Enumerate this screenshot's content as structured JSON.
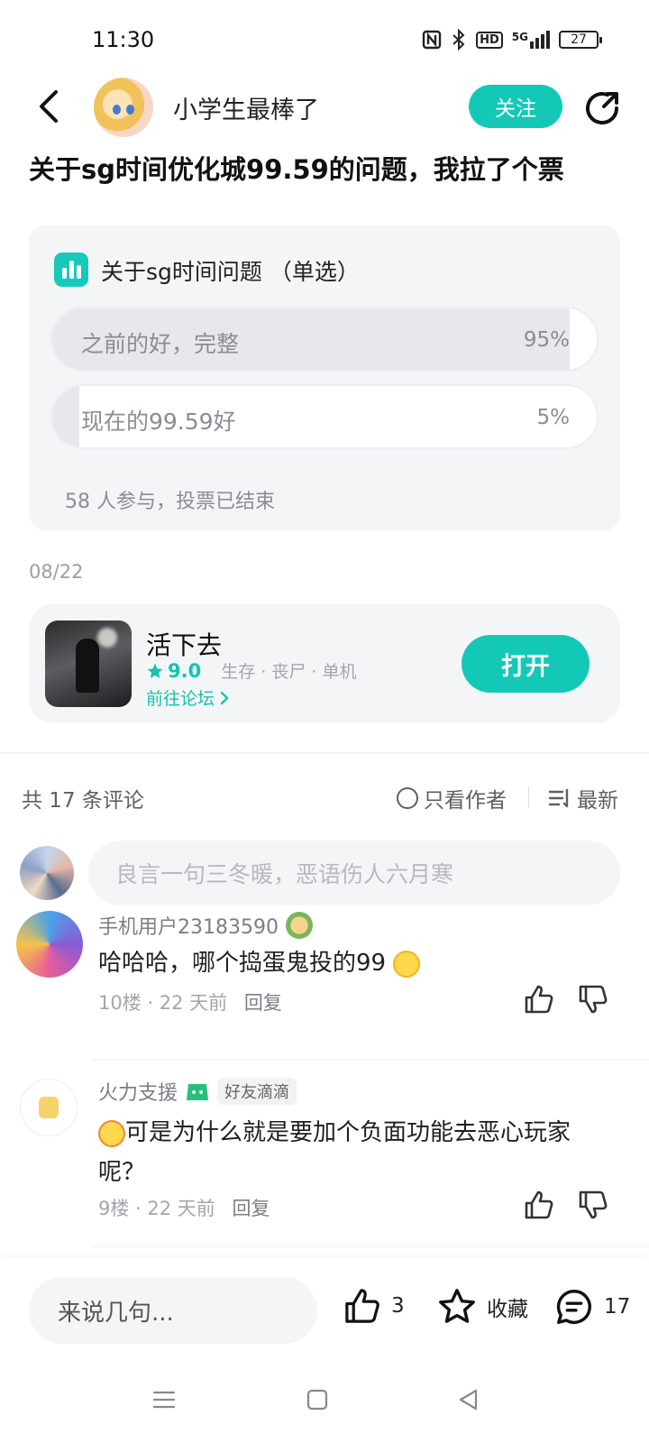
{
  "status_bar": {
    "time": "11:30",
    "icons": [
      "nfc-icon",
      "bluetooth-icon",
      "hd-icon",
      "5g-signal-icon"
    ],
    "hd_label": "HD",
    "network_label": "5G",
    "battery": "27"
  },
  "header": {
    "author_name": "小学生最棒了",
    "follow_label": "关注"
  },
  "post": {
    "title": "关于sg时间优化城99.59的问题，我拉了个票",
    "date": "08/22"
  },
  "poll": {
    "title": "关于sg时间问题 （单选）",
    "options": [
      {
        "label": "之前的好，完整",
        "percent_text": "95%",
        "percent": 95
      },
      {
        "label": "现在的99.59好",
        "percent_text": "5%",
        "percent": 5
      }
    ],
    "footer": "58 人参与，投票已结束"
  },
  "game": {
    "name": "活下去",
    "rating": "9.0",
    "tags": "生存 · 丧尸 · 单机",
    "forum_link": "前往论坛",
    "open_label": "打开"
  },
  "comments_section": {
    "count_label": "共 17 条评论",
    "author_only_label": "只看作者",
    "sort_label": "最新",
    "input_placeholder": "良言一句三冬暖，恶语伤人六月寒",
    "items": [
      {
        "user": "手机用户23183590",
        "text": "哈哈哈，哪个捣蛋鬼投的99",
        "meta": "10楼 · 22 天前",
        "reply": "回复"
      },
      {
        "user": "火力支援",
        "badge": "好友滴滴",
        "text_line1": "可是为什么就是要加个负面功能去恶心玩家",
        "text_line2": "呢？",
        "meta": "9楼 · 22 天前",
        "reply": "回复"
      }
    ]
  },
  "bottom_bar": {
    "input_placeholder": "来说几句...",
    "like_count": "3",
    "favorite_label": "收藏",
    "comment_count": "17"
  },
  "colors": {
    "accent": "#14c8b8",
    "card_bg": "#f4f5f7",
    "muted_text": "#8a8d92"
  }
}
